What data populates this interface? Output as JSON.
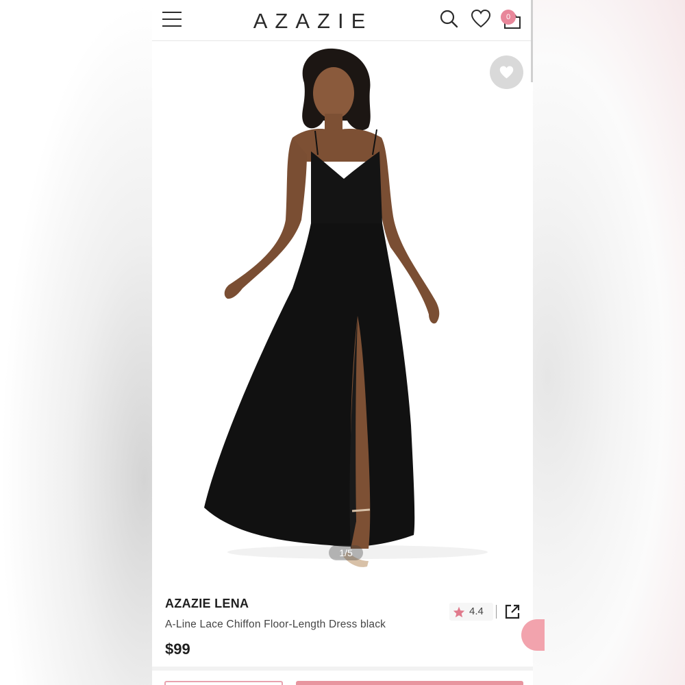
{
  "header": {
    "logo": "AZAZIE",
    "cart_count": "0",
    "icons": [
      "menu-icon",
      "search-icon",
      "heart-icon",
      "cart-icon"
    ]
  },
  "gallery": {
    "counter": "1/5",
    "favorite_icon": "heart-icon"
  },
  "product": {
    "brand": "AZAZIE LENA",
    "description": "A-Line Lace Chiffon Floor-Length Dress black",
    "price": "$99",
    "rating": "4.4",
    "rating_icon": "star-icon",
    "share_icon": "share-icon"
  },
  "colors": {
    "accent": "#e8879a",
    "button_fill": "#e8959f",
    "text_dark": "#1f1f1f"
  }
}
